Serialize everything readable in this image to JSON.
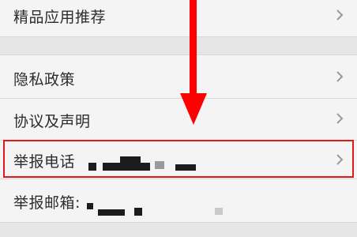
{
  "menu": {
    "items": [
      {
        "label": "精品应用推荐"
      },
      {
        "label": "隐私政策"
      },
      {
        "label": "协议及声明"
      },
      {
        "label": "举报电话"
      },
      {
        "label": "举报邮箱:"
      }
    ]
  },
  "icons": {
    "chevron": "chevron-right-icon",
    "arrow": "red-arrow-down-icon"
  },
  "colors": {
    "highlight": "#e11919",
    "arrow": "#ff0000",
    "row_background": "#f4f4f4",
    "section_gap": "#e6e6e6"
  }
}
